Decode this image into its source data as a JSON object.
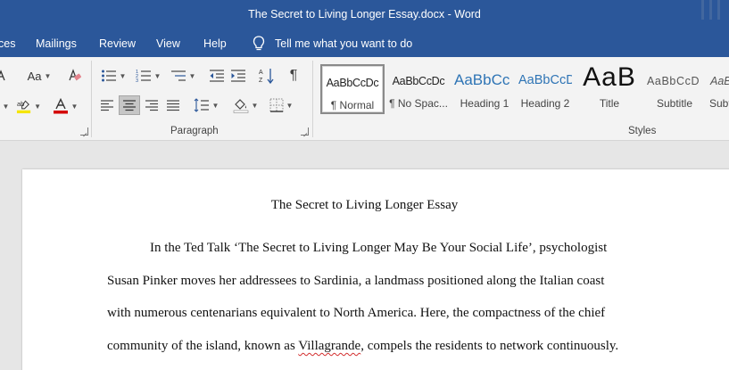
{
  "window": {
    "title": "The Secret to Living Longer Essay.docx  -  Word"
  },
  "menu": {
    "tabs": [
      "ces",
      "Mailings",
      "Review",
      "View",
      "Help"
    ],
    "tell_me": "Tell me what you want to do"
  },
  "ribbon": {
    "font_size_case": "Aa",
    "paragraph_label": "Paragraph",
    "styles_label": "Styles",
    "colors": {
      "highlight": "#f5e500",
      "font_color": "#d40000",
      "accent": "#2b579a"
    },
    "styles": [
      {
        "sample": "AaBbCcDc",
        "name": "¶ Normal",
        "selected": true
      },
      {
        "sample": "AaBbCcDc",
        "name": "¶ No Spac...",
        "selected": false
      },
      {
        "sample": "AaBbCc",
        "name": "Heading 1",
        "selected": false
      },
      {
        "sample": "AaBbCcD",
        "name": "Heading 2",
        "selected": false
      },
      {
        "sample": "AaB",
        "name": "Title",
        "selected": false
      },
      {
        "sample": "AaBbCcD",
        "name": "Subtitle",
        "selected": false
      },
      {
        "sample": "AaB",
        "name": "Subt",
        "selected": false
      }
    ]
  },
  "document": {
    "title": "The Secret to Living Longer Essay",
    "lines": [
      "In the Ted Talk ‘The Secret to Living Longer May Be Your Social Life’, psychologist",
      "Susan Pinker moves her addressees to Sardinia, a landmass positioned along the Italian coast",
      "with numerous centenarians equivalent to North America. Here, the compactness of the chief"
    ],
    "line4_before": "community of the island, known as ",
    "line4_misspelled": "Villagrande",
    "line4_after": ", compels the residents to network continuously."
  }
}
